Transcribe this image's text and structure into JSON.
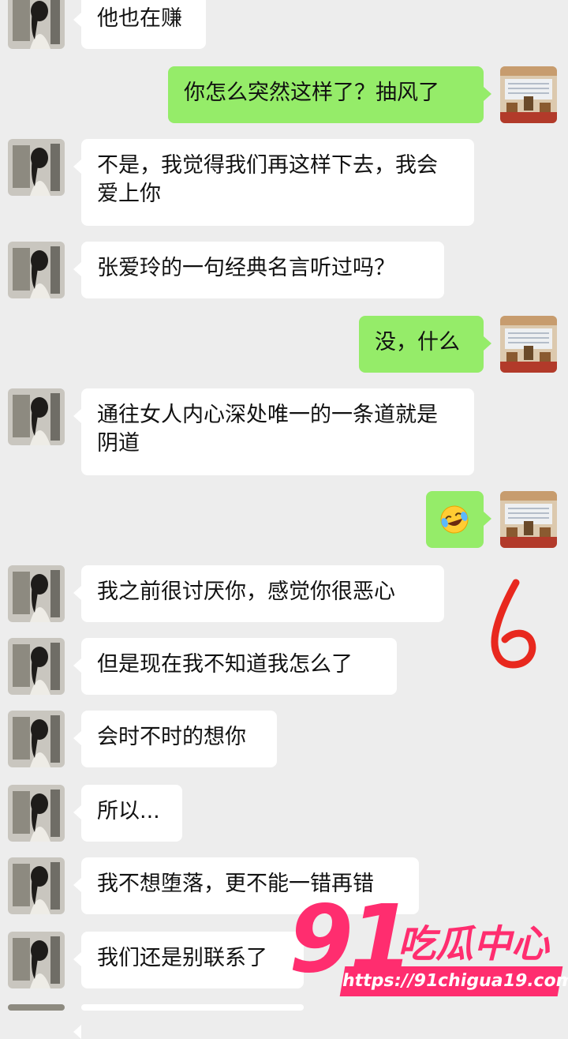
{
  "messages": [
    {
      "side": "left",
      "text": "他也在赚"
    },
    {
      "side": "right",
      "text": "你怎么突然这样了？抽风了"
    },
    {
      "side": "left",
      "text": "不是，我觉得我们再这样下去，我会爱上你"
    },
    {
      "side": "left",
      "text": "张爱玲的一句经典名言听过吗？"
    },
    {
      "side": "right",
      "text": "没，什么"
    },
    {
      "side": "left",
      "text": "通往女人内心深处唯一的一条道就是阴道"
    },
    {
      "side": "right",
      "text": "",
      "emoji": "laughing-crying-emoji"
    },
    {
      "side": "left",
      "text": "我之前很讨厌你，感觉你很恶心"
    },
    {
      "side": "left",
      "text": "但是现在我不知道我怎么了"
    },
    {
      "side": "left",
      "text": "会时不时的想你"
    },
    {
      "side": "left",
      "text": "所以..."
    },
    {
      "side": "left",
      "text": "我不想堕落，更不能一错再错"
    },
    {
      "side": "left",
      "text": "我们还是别联系了"
    }
  ],
  "annotation": {
    "text": "6",
    "color": "#e8281e"
  },
  "watermark": {
    "number": "91",
    "brand": "吃瓜中心",
    "url": "https://91chigua19.com",
    "color": "#ff2d6f"
  },
  "colors": {
    "background": "#ededed",
    "incoming": "#ffffff",
    "outgoing": "#95ec69"
  }
}
